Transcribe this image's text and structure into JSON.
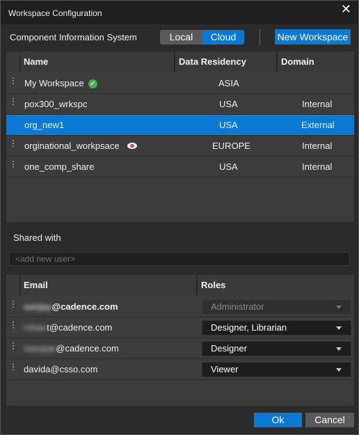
{
  "window": {
    "title": "Workspace Configuration",
    "close_icon": "close-icon"
  },
  "toolbar": {
    "label": "Component Information System",
    "toggle": {
      "options": [
        "Local",
        "Cloud"
      ],
      "selected": "Cloud"
    },
    "new_workspace_label": "New Workspace"
  },
  "workspaces": {
    "columns": [
      "Name",
      "Data Residency",
      "Domain"
    ],
    "rows": [
      {
        "name": "My Workspace",
        "residency": "ASIA",
        "domain": "",
        "icon": "check-circle-icon"
      },
      {
        "name": "pox300_wrkspc",
        "residency": "USA",
        "domain": "Internal"
      },
      {
        "name": "org_new1",
        "residency": "USA",
        "domain": "External",
        "selected": true
      },
      {
        "name": "orginational_workpsace",
        "residency": "EUROPE",
        "domain": "Internal",
        "icon": "eye-icon"
      },
      {
        "name": "one_comp_share",
        "residency": "USA",
        "domain": "Internal"
      }
    ]
  },
  "shared": {
    "label": "Shared with",
    "add_user_placeholder": "<add new user>",
    "columns": [
      "Email",
      "Roles"
    ],
    "rows": [
      {
        "email_obscured": "sanjay",
        "email_domain": "@cadence.com",
        "role": "Administrator",
        "disabled": true
      },
      {
        "email_obscured": "rohan",
        "email_domain": "t@cadence.com",
        "role": "Designer, Librarian"
      },
      {
        "email_obscured": "vasupar",
        "email_domain": "@cadence.com",
        "role": "Designer"
      },
      {
        "email_obscured": "",
        "email_domain": "davida@csso.com",
        "role": "Viewer"
      }
    ]
  },
  "footer": {
    "ok_label": "Ok",
    "cancel_label": "Cancel"
  },
  "colors": {
    "accent": "#0a79d4",
    "background": "#2b2b2b",
    "check": "#3ab34a"
  }
}
